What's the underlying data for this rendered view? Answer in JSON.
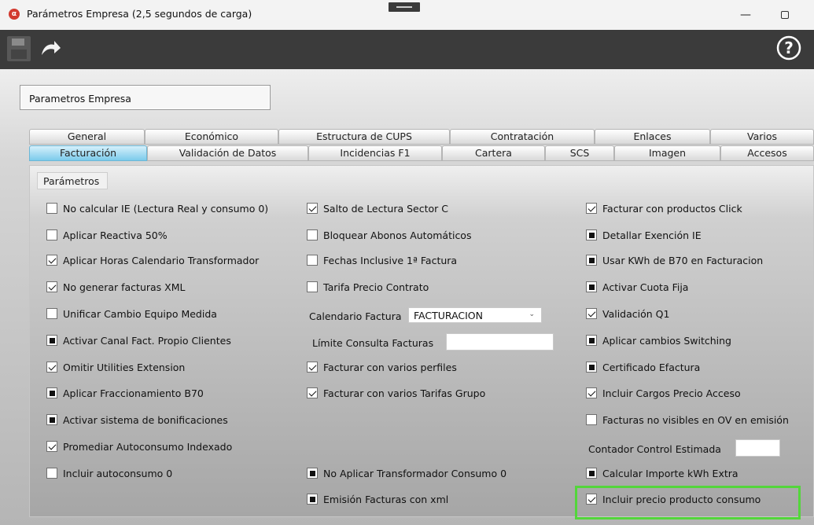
{
  "window": {
    "title": "Parámetros Empresa (2,5 segundos de carga)",
    "app_icon": "app-logo-icon",
    "min_glyph": "—"
  },
  "toolbar": {
    "icons": [
      "floppy-save-icon",
      "reload-arrow-icon",
      "help-icon"
    ],
    "help_glyph": "?"
  },
  "header": {
    "title": "Parametros Empresa"
  },
  "tabs": {
    "row1": [
      "General",
      "Económico",
      "Estructura de CUPS",
      "Contratación",
      "Enlaces",
      "Varios"
    ],
    "row2": [
      "Facturación",
      "Validación de Datos",
      "Incidencias F1",
      "Cartera",
      "SCS",
      "Imagen",
      "Accesos"
    ],
    "active": "Facturación",
    "active_color": "#7ccbeb"
  },
  "section": {
    "label": "Parámetros"
  },
  "options": {
    "col1": [
      {
        "label": "No calcular IE (Lectura Real y consumo 0)",
        "state": "unchecked"
      },
      {
        "label": "Aplicar Reactiva 50%",
        "state": "unchecked"
      },
      {
        "label": "Aplicar Horas Calendario Transformador",
        "state": "checked"
      },
      {
        "label": "No generar facturas XML",
        "state": "checked"
      },
      {
        "label": "Unificar Cambio Equipo Medida",
        "state": "unchecked"
      },
      {
        "label": "Activar Canal Fact. Propio Clientes",
        "state": "indeterminate"
      },
      {
        "label": "Omitir Utilities Extension",
        "state": "checked"
      },
      {
        "label": "Aplicar Fraccionamiento B70",
        "state": "indeterminate"
      },
      {
        "label": "Activar sistema de bonificaciones",
        "state": "indeterminate"
      },
      {
        "label": "Promediar Autoconsumo Indexado",
        "state": "checked"
      },
      {
        "label": "Incluir autoconsumo 0",
        "state": "unchecked"
      }
    ],
    "col2": [
      {
        "label": "Salto de Lectura Sector C",
        "state": "checked"
      },
      {
        "label": "Bloquear Abonos Automáticos",
        "state": "unchecked"
      },
      {
        "label": "Fechas Inclusive 1ª Factura",
        "state": "unchecked"
      },
      {
        "label": "Tarifa Precio Contrato",
        "state": "unchecked"
      },
      {
        "label": "Facturar con varios perfiles",
        "state": "checked"
      },
      {
        "label": "Facturar con varios Tarifas Grupo",
        "state": "checked"
      },
      {
        "label": "No Aplicar Transformador Consumo 0",
        "state": "indeterminate"
      },
      {
        "label": "Emisión Facturas con xml",
        "state": "indeterminate"
      }
    ],
    "col3": [
      {
        "label": "Facturar con productos Click",
        "state": "checked"
      },
      {
        "label": "Detallar Exención IE",
        "state": "indeterminate"
      },
      {
        "label": "Usar KWh de B70 en Facturacion",
        "state": "indeterminate"
      },
      {
        "label": "Activar Cuota Fija",
        "state": "indeterminate"
      },
      {
        "label": "Validación Q1",
        "state": "checked"
      },
      {
        "label": "Aplicar cambios Switching",
        "state": "indeterminate"
      },
      {
        "label": "Certificado Efactura",
        "state": "indeterminate"
      },
      {
        "label": "Incluir Cargos Precio Acceso",
        "state": "checked"
      },
      {
        "label": "Facturas no visibles en OV en emisión",
        "state": "unchecked"
      },
      {
        "label": "Calcular Importe kWh Extra",
        "state": "indeterminate"
      },
      {
        "label": "Incluir precio producto consumo",
        "state": "checked"
      }
    ]
  },
  "fields": {
    "calendario_label": "Calendario Factura",
    "calendario_value": "FACTURACION",
    "calendario_arrow": "⌄",
    "limite_label": "Límite Consulta Facturas",
    "limite_value": "",
    "contador_label": "Contador Control Estimada",
    "contador_value": ""
  },
  "highlight_color": "#53d63b"
}
